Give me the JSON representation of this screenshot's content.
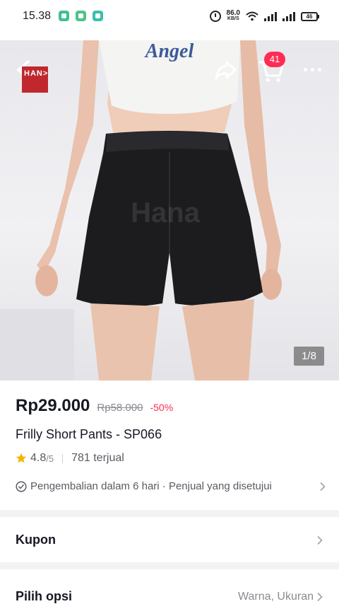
{
  "status_bar": {
    "time": "15.38",
    "net_speed_value": "86.0",
    "net_speed_unit": "KB/S",
    "battery": "46",
    "notification_icons": [
      "app-notification-icon",
      "app-notification-icon",
      "app-notification-icon"
    ]
  },
  "gallery": {
    "brand_logo": "HAN>",
    "shirt_print": "Angel",
    "watermark": "Hana",
    "cart_count": "41",
    "counter": "1/8"
  },
  "product": {
    "price": "Rp29.000",
    "original_price": "Rp58.000",
    "discount": "-50%",
    "title": "Frilly Short Pants - SP066",
    "rating": "4.8",
    "rating_max": "/5",
    "sold": "781 terjual",
    "policy": "Pengembalian dalam 6 hari · Penjual yang disetujui"
  },
  "sections": {
    "coupon_label": "Kupon",
    "options_label": "Pilih opsi",
    "options_value": "Warna, Ukuran"
  },
  "colors": {
    "accent": "#fe2c55",
    "rating_star": "#f5b400",
    "brand_logo": "#c0282d"
  }
}
